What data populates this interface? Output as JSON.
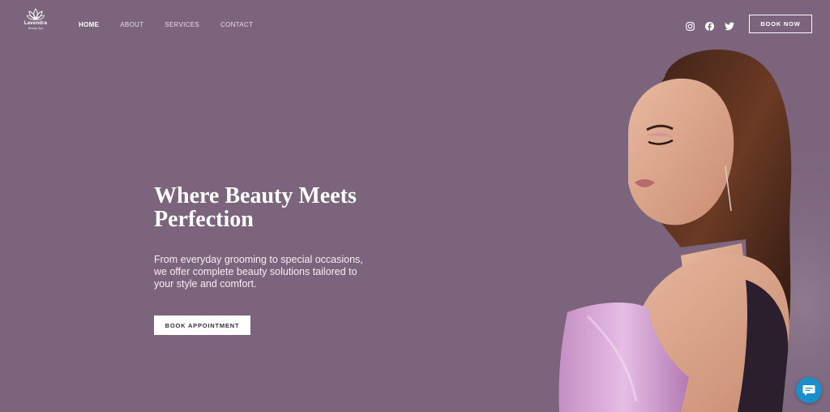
{
  "brand": {
    "name": "Lavendra",
    "tagline": "Beauty Spa"
  },
  "nav": {
    "items": [
      {
        "label": "HOME",
        "active": true
      },
      {
        "label": "ABOUT",
        "active": false
      },
      {
        "label": "SERVICES",
        "active": false
      },
      {
        "label": "CONTACT",
        "active": false
      }
    ]
  },
  "socials": [
    "instagram-icon",
    "facebook-icon",
    "twitter-icon"
  ],
  "header": {
    "cta_label": "BOOK NOW"
  },
  "hero": {
    "title": "Where Beauty Meets Perfection",
    "subtitle": "From everyday grooming to special occasions, we offer complete beauty solutions tailored to your style and comfort.",
    "cta_label": "BOOK APPOINTMENT"
  },
  "colors": {
    "background": "#7b647c",
    "chat": "#1a8fc9",
    "accent_dress": "#d8a6d6"
  }
}
